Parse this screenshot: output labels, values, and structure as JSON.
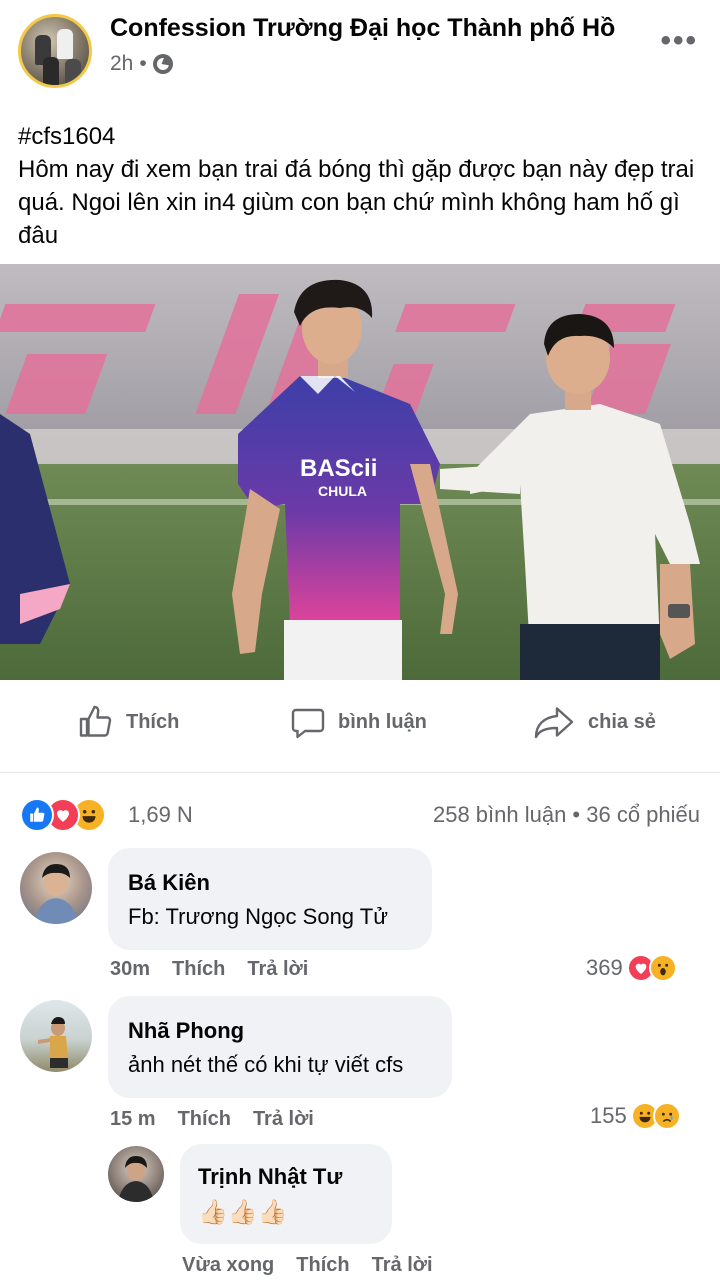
{
  "post": {
    "page_name": "Confession Trường Đại học Thành phố Hồ",
    "time": "2h",
    "separator": "•",
    "more_icon": "more-icon",
    "hashtag": "#cfs1604",
    "body_line1": "Hôm nay đi xem bạn trai đá bóng thì gặp được bạn này đẹp trai",
    "body_line2": "quá. Ngoi lên xin in4 giùm con bạn chứ mình không ham hố gì",
    "body_line3": "đâu",
    "photo_jersey_text": "BAScii",
    "photo_jersey_sub": "CHULA"
  },
  "actions": {
    "like": "Thích",
    "comment": "bình luận",
    "share": "chia sẻ"
  },
  "stats": {
    "reactions_count": "1,69 N",
    "comments_shares": "258 bình luận • 36 cổ phiếu"
  },
  "comments": [
    {
      "name": "Bá Kiên",
      "text": "Fb: Trương Ngọc Song Tử",
      "time": "30m",
      "like": "Thích",
      "reply": "Trả lời",
      "reaction_count": "369"
    },
    {
      "name": "Nhã Phong",
      "text": "ảnh nét thế có khi tự viết cfs",
      "time": "15 m",
      "like": "Thích",
      "reply": "Trả lời",
      "reaction_count": "155"
    },
    {
      "name": "Trịnh Nhật Tư",
      "text": "👍🏻👍🏻👍🏻",
      "time": "Vừa xong",
      "like": "Thích",
      "reply": "Trả lời"
    }
  ],
  "colors": {
    "like_blue": "#1877f2",
    "love_red": "#f33e58",
    "haha_yellow": "#f7b125",
    "meta_gray": "#65676b",
    "bubble_gray": "#f0f2f5"
  }
}
